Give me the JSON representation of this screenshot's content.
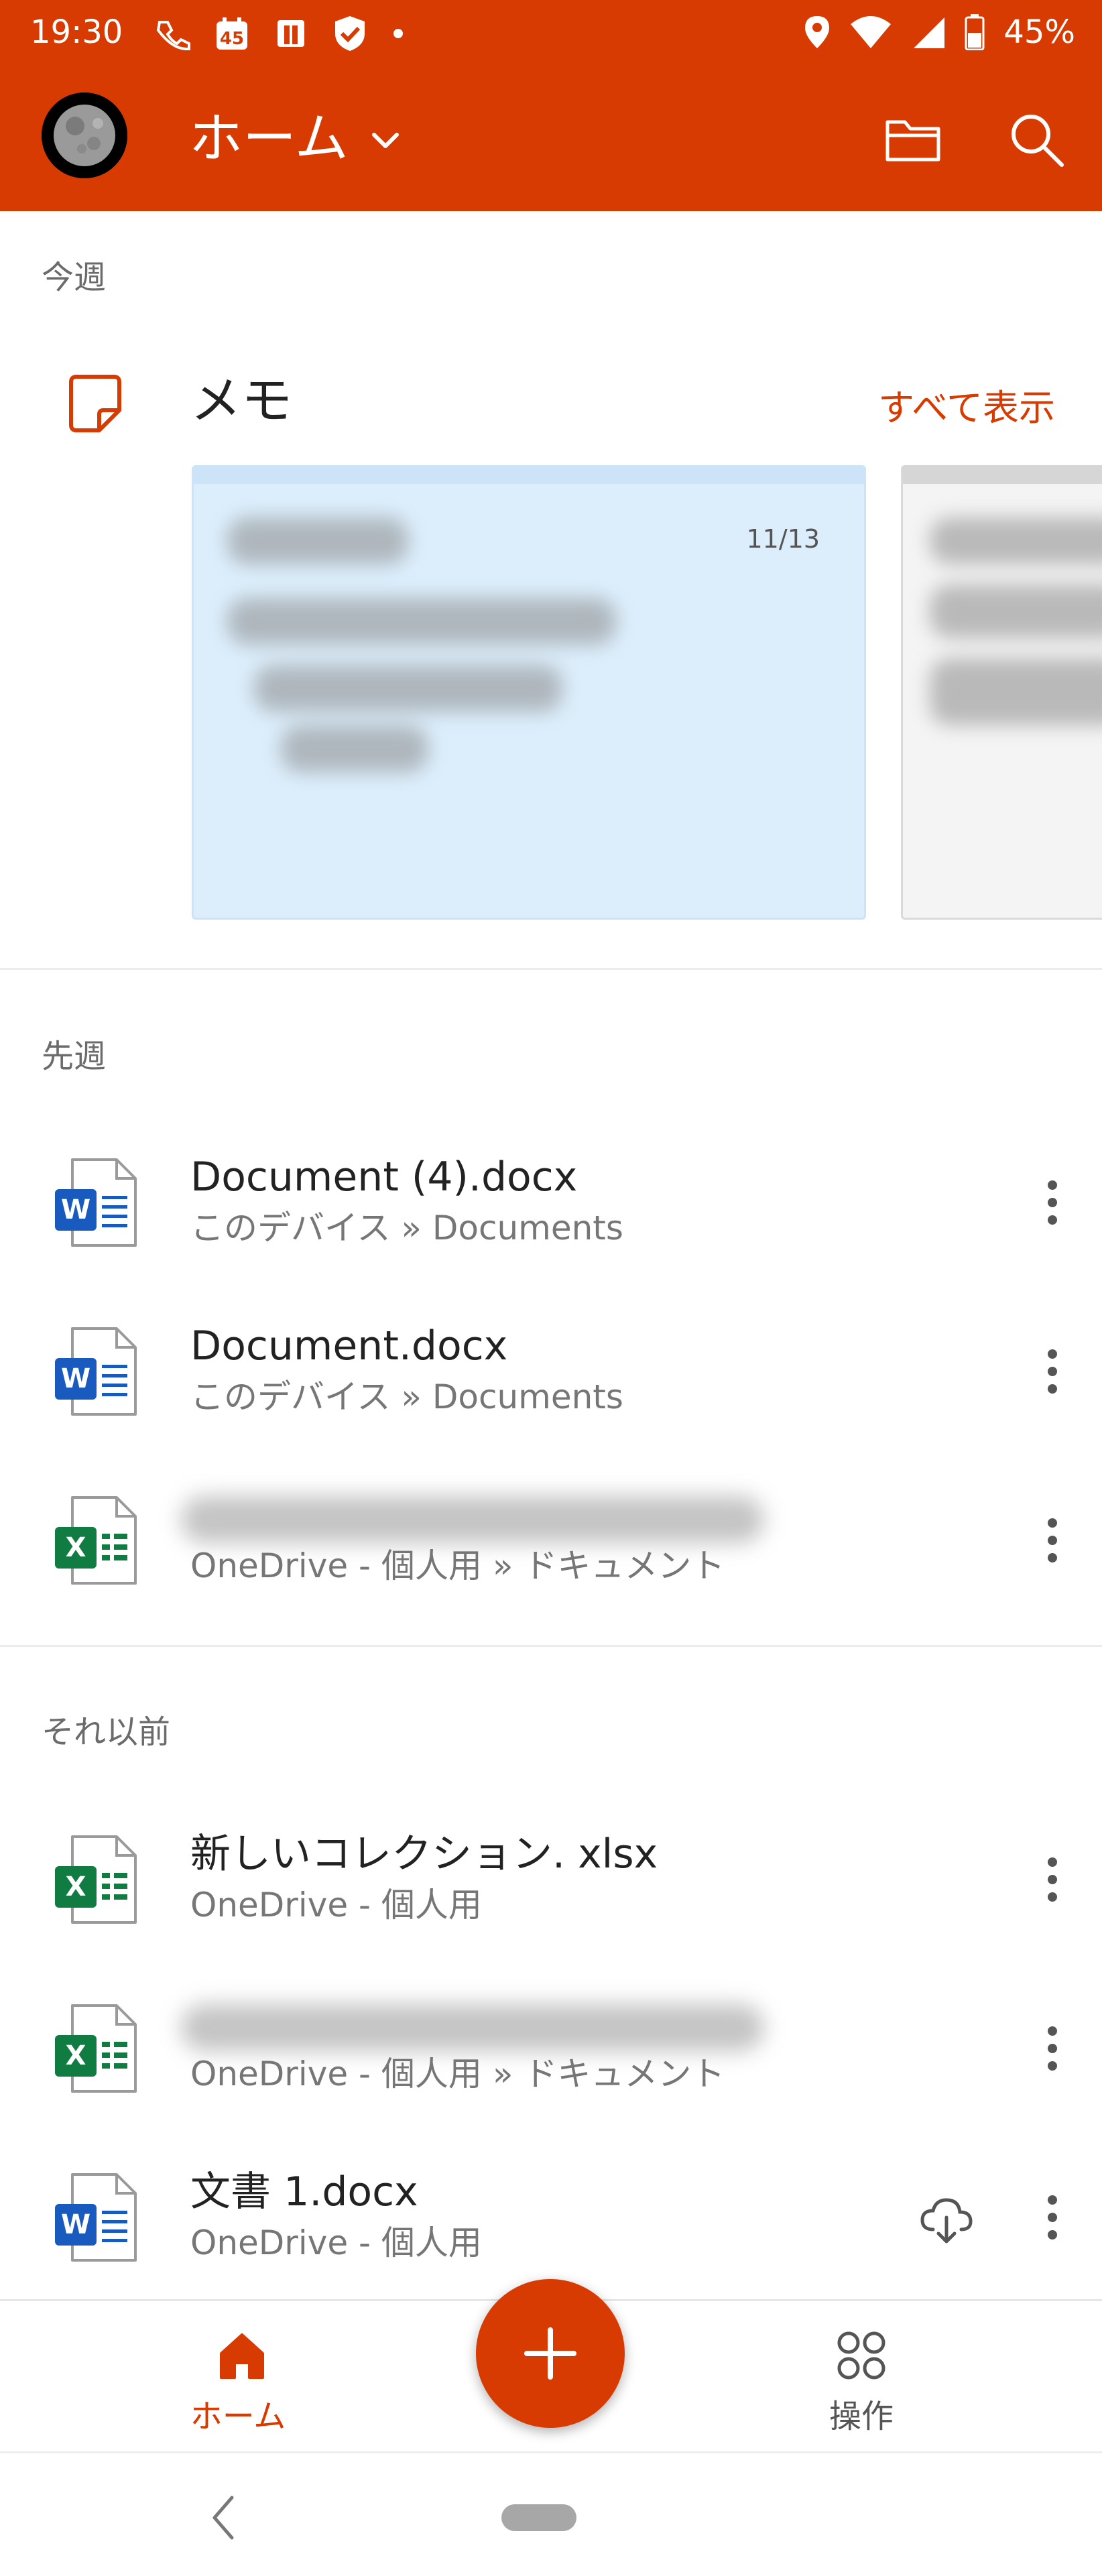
{
  "status_bar": {
    "time": "19:30",
    "battery": "45%",
    "icons": [
      "wifi-calling-icon",
      "calendar-45-icon",
      "nfc-icon",
      "shield-icon",
      "dot-icon",
      "location-icon",
      "wifi-icon",
      "signal-icon",
      "battery-icon"
    ]
  },
  "app_bar": {
    "title": "ホーム",
    "accent_color": "#D83B01"
  },
  "sections": {
    "this_week": "今週",
    "last_week": "先週",
    "earlier": "それ以前"
  },
  "memo": {
    "title": "メモ",
    "show_all": "すべて表示",
    "cards": [
      {
        "date": "11/13"
      }
    ]
  },
  "last_week_files": [
    {
      "name": "Document (4).docx",
      "location": "このデバイス » Documents",
      "type": "word"
    },
    {
      "name": "Document.docx",
      "location": "このデバイス » Documents",
      "type": "word"
    },
    {
      "name": "",
      "location": "OneDrive - 個人用 » ドキュメント",
      "type": "excel"
    }
  ],
  "earlier_files": [
    {
      "name": "新しいコレクション. xlsx",
      "location": "OneDrive - 個人用",
      "type": "excel"
    },
    {
      "name": "",
      "location": "OneDrive - 個人用 » ドキュメント",
      "type": "excel"
    },
    {
      "name": "文書 1.docx",
      "location": "OneDrive - 個人用",
      "type": "word"
    }
  ],
  "bottom_nav": {
    "home": "ホーム",
    "actions": "操作"
  }
}
